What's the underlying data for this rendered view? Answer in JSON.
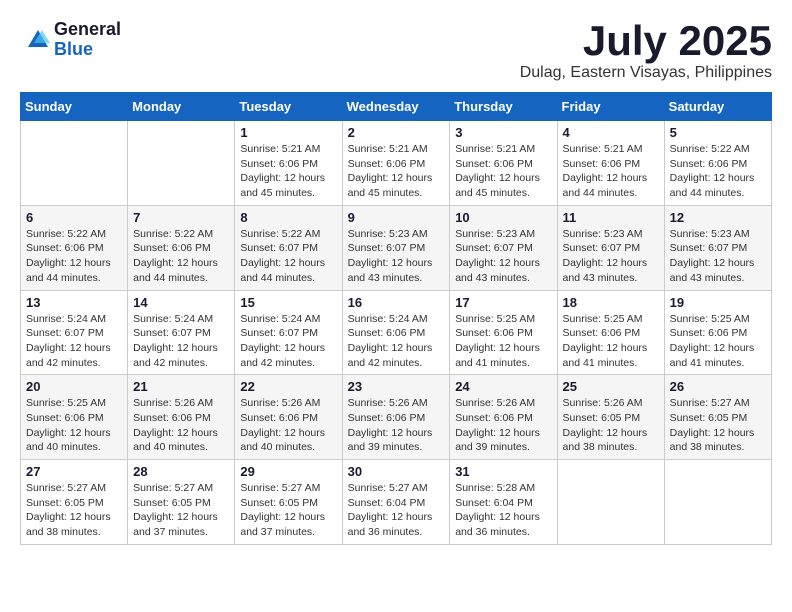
{
  "logo": {
    "general": "General",
    "blue": "Blue"
  },
  "title": {
    "month_year": "July 2025",
    "location": "Dulag, Eastern Visayas, Philippines"
  },
  "headers": [
    "Sunday",
    "Monday",
    "Tuesday",
    "Wednesday",
    "Thursday",
    "Friday",
    "Saturday"
  ],
  "weeks": [
    [
      {
        "day": "",
        "info": ""
      },
      {
        "day": "",
        "info": ""
      },
      {
        "day": "1",
        "sunrise": "Sunrise: 5:21 AM",
        "sunset": "Sunset: 6:06 PM",
        "daylight": "Daylight: 12 hours and 45 minutes."
      },
      {
        "day": "2",
        "sunrise": "Sunrise: 5:21 AM",
        "sunset": "Sunset: 6:06 PM",
        "daylight": "Daylight: 12 hours and 45 minutes."
      },
      {
        "day": "3",
        "sunrise": "Sunrise: 5:21 AM",
        "sunset": "Sunset: 6:06 PM",
        "daylight": "Daylight: 12 hours and 45 minutes."
      },
      {
        "day": "4",
        "sunrise": "Sunrise: 5:21 AM",
        "sunset": "Sunset: 6:06 PM",
        "daylight": "Daylight: 12 hours and 44 minutes."
      },
      {
        "day": "5",
        "sunrise": "Sunrise: 5:22 AM",
        "sunset": "Sunset: 6:06 PM",
        "daylight": "Daylight: 12 hours and 44 minutes."
      }
    ],
    [
      {
        "day": "6",
        "sunrise": "Sunrise: 5:22 AM",
        "sunset": "Sunset: 6:06 PM",
        "daylight": "Daylight: 12 hours and 44 minutes."
      },
      {
        "day": "7",
        "sunrise": "Sunrise: 5:22 AM",
        "sunset": "Sunset: 6:06 PM",
        "daylight": "Daylight: 12 hours and 44 minutes."
      },
      {
        "day": "8",
        "sunrise": "Sunrise: 5:22 AM",
        "sunset": "Sunset: 6:07 PM",
        "daylight": "Daylight: 12 hours and 44 minutes."
      },
      {
        "day": "9",
        "sunrise": "Sunrise: 5:23 AM",
        "sunset": "Sunset: 6:07 PM",
        "daylight": "Daylight: 12 hours and 43 minutes."
      },
      {
        "day": "10",
        "sunrise": "Sunrise: 5:23 AM",
        "sunset": "Sunset: 6:07 PM",
        "daylight": "Daylight: 12 hours and 43 minutes."
      },
      {
        "day": "11",
        "sunrise": "Sunrise: 5:23 AM",
        "sunset": "Sunset: 6:07 PM",
        "daylight": "Daylight: 12 hours and 43 minutes."
      },
      {
        "day": "12",
        "sunrise": "Sunrise: 5:23 AM",
        "sunset": "Sunset: 6:07 PM",
        "daylight": "Daylight: 12 hours and 43 minutes."
      }
    ],
    [
      {
        "day": "13",
        "sunrise": "Sunrise: 5:24 AM",
        "sunset": "Sunset: 6:07 PM",
        "daylight": "Daylight: 12 hours and 42 minutes."
      },
      {
        "day": "14",
        "sunrise": "Sunrise: 5:24 AM",
        "sunset": "Sunset: 6:07 PM",
        "daylight": "Daylight: 12 hours and 42 minutes."
      },
      {
        "day": "15",
        "sunrise": "Sunrise: 5:24 AM",
        "sunset": "Sunset: 6:07 PM",
        "daylight": "Daylight: 12 hours and 42 minutes."
      },
      {
        "day": "16",
        "sunrise": "Sunrise: 5:24 AM",
        "sunset": "Sunset: 6:06 PM",
        "daylight": "Daylight: 12 hours and 42 minutes."
      },
      {
        "day": "17",
        "sunrise": "Sunrise: 5:25 AM",
        "sunset": "Sunset: 6:06 PM",
        "daylight": "Daylight: 12 hours and 41 minutes."
      },
      {
        "day": "18",
        "sunrise": "Sunrise: 5:25 AM",
        "sunset": "Sunset: 6:06 PM",
        "daylight": "Daylight: 12 hours and 41 minutes."
      },
      {
        "day": "19",
        "sunrise": "Sunrise: 5:25 AM",
        "sunset": "Sunset: 6:06 PM",
        "daylight": "Daylight: 12 hours and 41 minutes."
      }
    ],
    [
      {
        "day": "20",
        "sunrise": "Sunrise: 5:25 AM",
        "sunset": "Sunset: 6:06 PM",
        "daylight": "Daylight: 12 hours and 40 minutes."
      },
      {
        "day": "21",
        "sunrise": "Sunrise: 5:26 AM",
        "sunset": "Sunset: 6:06 PM",
        "daylight": "Daylight: 12 hours and 40 minutes."
      },
      {
        "day": "22",
        "sunrise": "Sunrise: 5:26 AM",
        "sunset": "Sunset: 6:06 PM",
        "daylight": "Daylight: 12 hours and 40 minutes."
      },
      {
        "day": "23",
        "sunrise": "Sunrise: 5:26 AM",
        "sunset": "Sunset: 6:06 PM",
        "daylight": "Daylight: 12 hours and 39 minutes."
      },
      {
        "day": "24",
        "sunrise": "Sunrise: 5:26 AM",
        "sunset": "Sunset: 6:06 PM",
        "daylight": "Daylight: 12 hours and 39 minutes."
      },
      {
        "day": "25",
        "sunrise": "Sunrise: 5:26 AM",
        "sunset": "Sunset: 6:05 PM",
        "daylight": "Daylight: 12 hours and 38 minutes."
      },
      {
        "day": "26",
        "sunrise": "Sunrise: 5:27 AM",
        "sunset": "Sunset: 6:05 PM",
        "daylight": "Daylight: 12 hours and 38 minutes."
      }
    ],
    [
      {
        "day": "27",
        "sunrise": "Sunrise: 5:27 AM",
        "sunset": "Sunset: 6:05 PM",
        "daylight": "Daylight: 12 hours and 38 minutes."
      },
      {
        "day": "28",
        "sunrise": "Sunrise: 5:27 AM",
        "sunset": "Sunset: 6:05 PM",
        "daylight": "Daylight: 12 hours and 37 minutes."
      },
      {
        "day": "29",
        "sunrise": "Sunrise: 5:27 AM",
        "sunset": "Sunset: 6:05 PM",
        "daylight": "Daylight: 12 hours and 37 minutes."
      },
      {
        "day": "30",
        "sunrise": "Sunrise: 5:27 AM",
        "sunset": "Sunset: 6:04 PM",
        "daylight": "Daylight: 12 hours and 36 minutes."
      },
      {
        "day": "31",
        "sunrise": "Sunrise: 5:28 AM",
        "sunset": "Sunset: 6:04 PM",
        "daylight": "Daylight: 12 hours and 36 minutes."
      },
      {
        "day": "",
        "info": ""
      },
      {
        "day": "",
        "info": ""
      }
    ]
  ]
}
